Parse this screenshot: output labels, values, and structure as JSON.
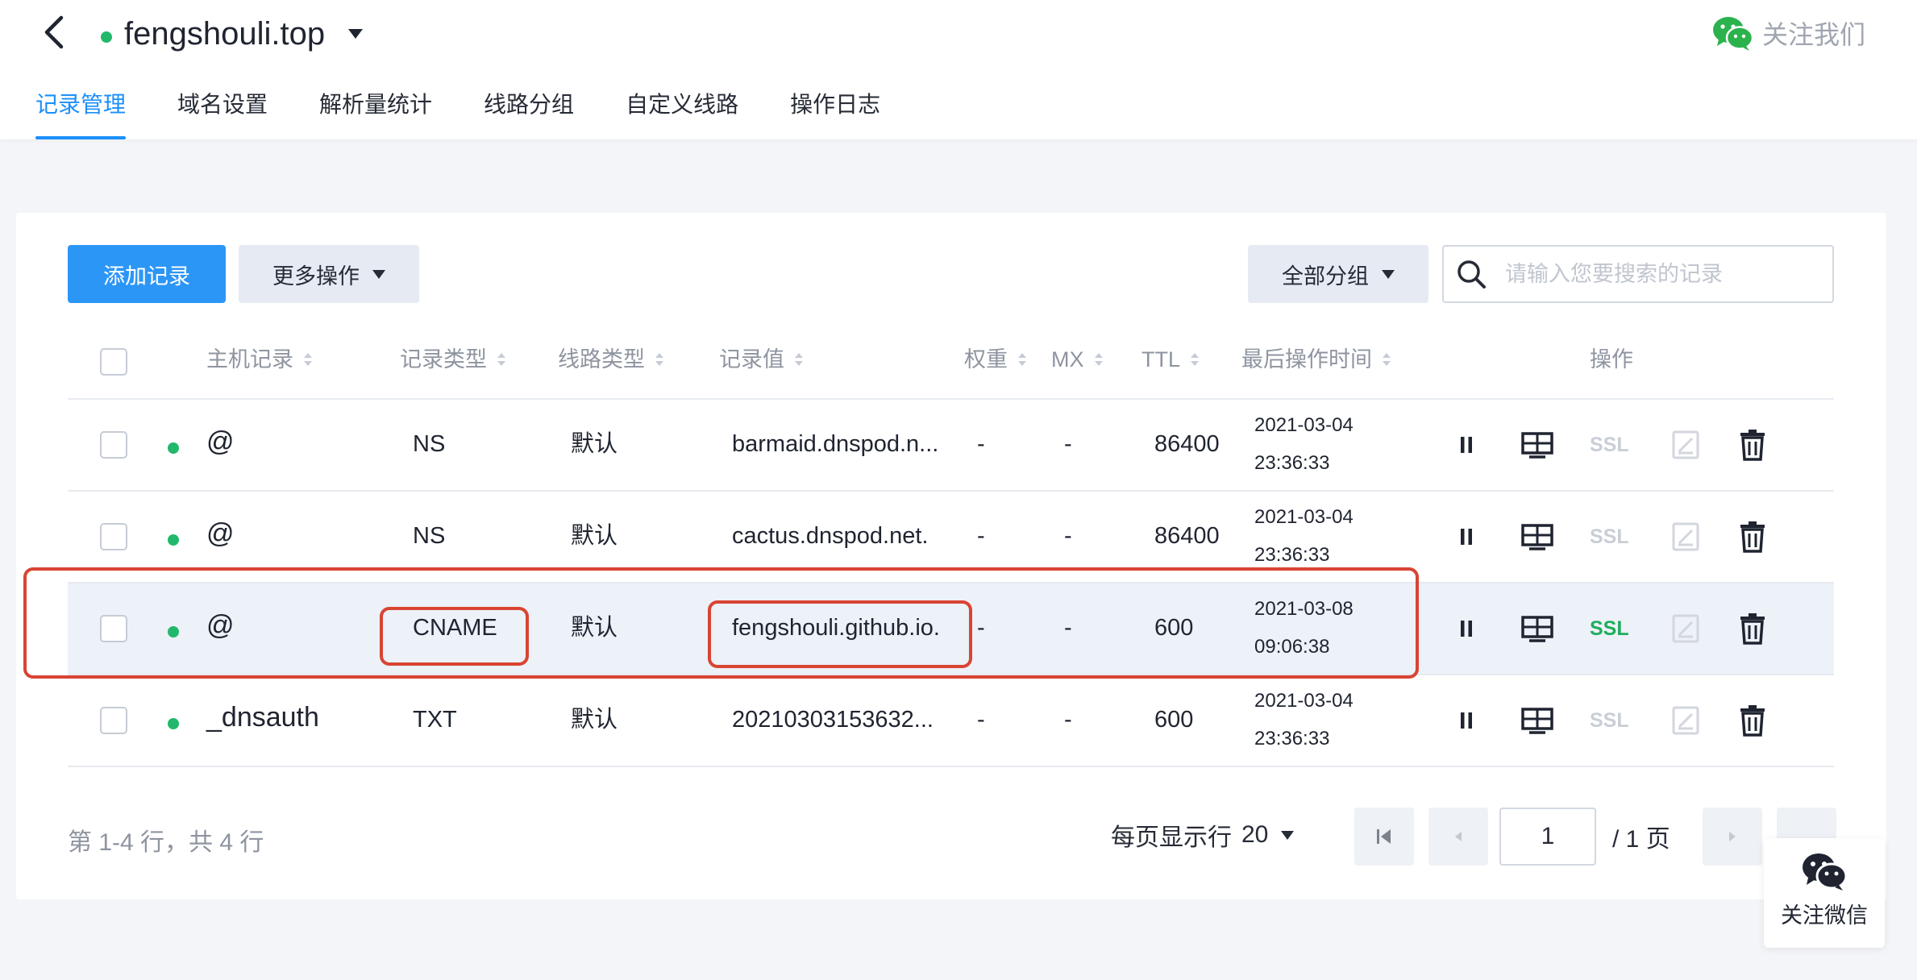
{
  "header": {
    "domain": "fengshouli.top",
    "follow_label": "关注我们"
  },
  "tabs": [
    {
      "label": "记录管理",
      "active": true
    },
    {
      "label": "域名设置"
    },
    {
      "label": "解析量统计"
    },
    {
      "label": "线路分组"
    },
    {
      "label": "自定义线路"
    },
    {
      "label": "操作日志"
    }
  ],
  "toolbar": {
    "add_label": "添加记录",
    "more_label": "更多操作",
    "group_label": "全部分组",
    "search_placeholder": "请输入您要搜索的记录"
  },
  "table": {
    "columns": {
      "host": "主机记录",
      "type": "记录类型",
      "line": "线路类型",
      "value": "记录值",
      "weight": "权重",
      "mx": "MX",
      "ttl": "TTL",
      "updated": "最后操作时间",
      "ops": "操作"
    },
    "rows": [
      {
        "host": "@",
        "type": "NS",
        "line": "默认",
        "value": "barmaid.dnspod.n...",
        "weight": "-",
        "mx": "-",
        "ttl": "86400",
        "date": "2021-03-04",
        "time": "23:36:33",
        "ssl": "SSL",
        "ssl_enabled": false
      },
      {
        "host": "@",
        "type": "NS",
        "line": "默认",
        "value": "cactus.dnspod.net.",
        "weight": "-",
        "mx": "-",
        "ttl": "86400",
        "date": "2021-03-04",
        "time": "23:36:33",
        "ssl": "SSL",
        "ssl_enabled": false
      },
      {
        "host": "@",
        "type": "CNAME",
        "line": "默认",
        "value": "fengshouli.github.io.",
        "weight": "-",
        "mx": "-",
        "ttl": "600",
        "date": "2021-03-08",
        "time": "09:06:38",
        "ssl": "SSL",
        "ssl_enabled": true,
        "highlighted": true
      },
      {
        "host": "_dnsauth",
        "type": "TXT",
        "line": "默认",
        "value": "20210303153632...",
        "weight": "-",
        "mx": "-",
        "ttl": "600",
        "date": "2021-03-04",
        "time": "23:36:33",
        "ssl": "SSL",
        "ssl_enabled": false
      }
    ]
  },
  "pagination": {
    "summary": "第 1-4 行，共 4 行",
    "per_page_label": "每页显示行",
    "per_page": "20",
    "current_page": "1",
    "total_pages": "/ 1 页"
  },
  "float_follow_label": "关注微信",
  "colors": {
    "primary": "#2c96f7",
    "tab_active": "#1b8ffb",
    "status_ok": "#22b86b",
    "ssl_enabled": "#1fae5c",
    "ssl_disabled": "#c9ced6",
    "highlight_border": "#d94433"
  }
}
